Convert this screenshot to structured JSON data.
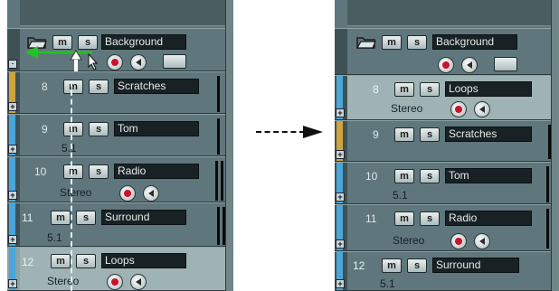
{
  "buttons": {
    "mute": "m",
    "solo": "s"
  },
  "left": {
    "folder": {
      "name": "Background"
    },
    "tracks": [
      {
        "number": "8",
        "name": "Scratches",
        "sub": "",
        "color": "#d0a43c"
      },
      {
        "number": "9",
        "name": "Tom",
        "sub": "5.1",
        "color": "#4aa6d9"
      },
      {
        "number": "10",
        "name": "Radio",
        "sub": "Stereo",
        "color": "#4aa6d9"
      },
      {
        "number": "11",
        "name": "Surround",
        "sub": "5.1",
        "color": "#4aa6d9"
      },
      {
        "number": "12",
        "name": "Loops",
        "sub": "Stereo",
        "color": "#4aa6d9"
      }
    ]
  },
  "right": {
    "folder": {
      "name": "Background"
    },
    "tracks": [
      {
        "number": "8",
        "name": "Loops",
        "sub": "Stereo",
        "color": "#4aa6d9"
      },
      {
        "number": "9",
        "name": "Scratches",
        "sub": "",
        "color": "#d0a43c"
      },
      {
        "number": "10",
        "name": "Tom",
        "sub": "5.1",
        "color": "#4aa6d9"
      },
      {
        "number": "11",
        "name": "Radio",
        "sub": "Stereo",
        "color": "#4aa6d9"
      },
      {
        "number": "12",
        "name": "Surround",
        "sub": "5.1",
        "color": "#4aa6d9"
      }
    ]
  },
  "colors": {
    "drag_arrow": "#22c422",
    "panel": "#54686e",
    "track_blue": "#4aa6d9",
    "track_yellow": "#d0a43c"
  }
}
